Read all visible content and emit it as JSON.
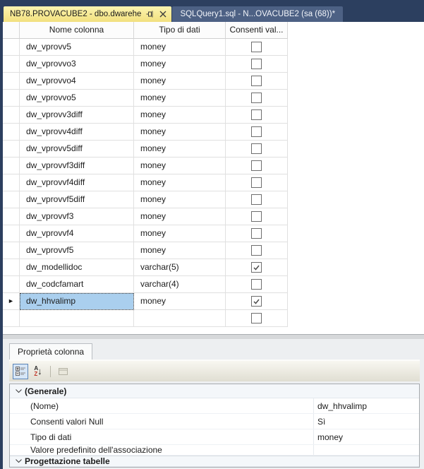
{
  "tabs": [
    {
      "label": "NB78.PROVACUBE2 - dbo.dwarehe",
      "active": true
    },
    {
      "label": "SQLQuery1.sql - N...OVACUBE2 (sa (68))*",
      "active": false
    }
  ],
  "grid": {
    "columns": [
      "Nome colonna",
      "Tipo di dati",
      "Consenti val..."
    ],
    "rows": [
      {
        "name": "dw_vprovv5",
        "type": "money",
        "nullable": false,
        "selected": false
      },
      {
        "name": "dw_vprovvo3",
        "type": "money",
        "nullable": false,
        "selected": false
      },
      {
        "name": "dw_vprovvo4",
        "type": "money",
        "nullable": false,
        "selected": false
      },
      {
        "name": "dw_vprovvo5",
        "type": "money",
        "nullable": false,
        "selected": false
      },
      {
        "name": "dw_vprovv3diff",
        "type": "money",
        "nullable": false,
        "selected": false
      },
      {
        "name": "dw_vprovv4diff",
        "type": "money",
        "nullable": false,
        "selected": false
      },
      {
        "name": "dw_vprovv5diff",
        "type": "money",
        "nullable": false,
        "selected": false
      },
      {
        "name": "dw_vprovvf3diff",
        "type": "money",
        "nullable": false,
        "selected": false
      },
      {
        "name": "dw_vprovvf4diff",
        "type": "money",
        "nullable": false,
        "selected": false
      },
      {
        "name": "dw_vprovvf5diff",
        "type": "money",
        "nullable": false,
        "selected": false
      },
      {
        "name": "dw_vprovvf3",
        "type": "money",
        "nullable": false,
        "selected": false
      },
      {
        "name": "dw_vprovvf4",
        "type": "money",
        "nullable": false,
        "selected": false
      },
      {
        "name": "dw_vprovvf5",
        "type": "money",
        "nullable": false,
        "selected": false
      },
      {
        "name": "dw_modellidoc",
        "type": "varchar(5)",
        "nullable": true,
        "selected": false
      },
      {
        "name": "dw_codcfamart",
        "type": "varchar(4)",
        "nullable": false,
        "selected": false
      },
      {
        "name": "dw_hhvalimp",
        "type": "money",
        "nullable": true,
        "selected": true
      },
      {
        "name": "",
        "type": "",
        "nullable": false,
        "selected": false
      }
    ]
  },
  "properties_panel": {
    "tab_label": "Proprietà colonna",
    "toolbar": {
      "sort_letters": [
        "A",
        "Z"
      ]
    },
    "groups": [
      {
        "label": "(Generale)",
        "items": [
          {
            "name": "(Nome)",
            "value": "dw_hhvalimp"
          },
          {
            "name": "Consenti valori Null",
            "value": "Sì"
          },
          {
            "name": "Tipo di dati",
            "value": "money"
          },
          {
            "name": "Valore predefinito dell'associazione",
            "value": ""
          }
        ]
      },
      {
        "label": "Progettazione tabelle",
        "items": []
      }
    ]
  },
  "colors": {
    "tab_bar_background": "#2c3f5f",
    "active_tab": "#f5e58c",
    "inactive_tab": "#4d6184",
    "selected_cell": "#aacfee"
  }
}
